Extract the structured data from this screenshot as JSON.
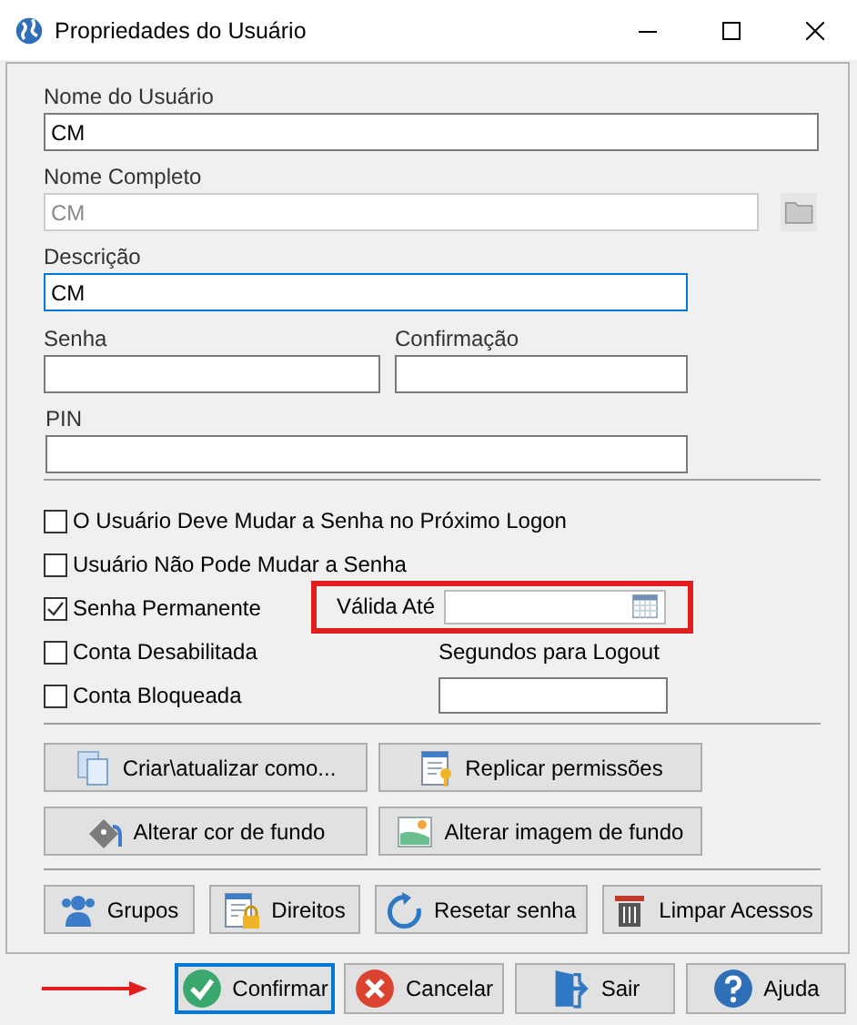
{
  "window": {
    "title": "Propriedades do Usuário",
    "controls": [
      {
        "kind": "minimize"
      },
      {
        "kind": "maximize"
      },
      {
        "kind": "close"
      }
    ]
  },
  "user_name": {
    "label": "Nome do Usuário",
    "value": "CM",
    "disabled": false,
    "focused": false
  },
  "full_name": {
    "label": "Nome Completo",
    "value": "CM",
    "disabled": true,
    "focused": false
  },
  "description": {
    "label": "Descrição",
    "value": "CM",
    "disabled": false,
    "focused": true
  },
  "password": {
    "label": "Senha",
    "disabled": false,
    "focused": false
  },
  "confirmation": {
    "label": "Confirmação",
    "disabled": false,
    "focused": false
  },
  "pin": {
    "label": "PIN",
    "disabled": false,
    "focused": false
  },
  "options": [
    {
      "label": "O Usuário Deve Mudar a Senha no Próximo Logon",
      "checked": false
    },
    {
      "label": "Usuário Não Pode Mudar a Senha",
      "checked": false
    },
    {
      "label": "Senha Permanente",
      "checked": true
    },
    {
      "label": "Conta Desabilitada",
      "checked": false
    },
    {
      "label": "Conta Bloqueada",
      "checked": false
    }
  ],
  "valid_until": {
    "label": "Válida Até",
    "highlighted": true
  },
  "logout_seconds": {
    "label": "Segundos para Logout"
  },
  "tool_buttons": [
    {
      "label": "Criar\\atualizar como...",
      "kind": "copy"
    },
    {
      "label": "Replicar permissões",
      "kind": "permissions"
    },
    {
      "label": "Alterar cor de fundo",
      "kind": "paint"
    },
    {
      "label": "Alterar imagem de fundo",
      "kind": "image"
    }
  ],
  "action_buttons": [
    {
      "label": "Grupos",
      "kind": "groups"
    },
    {
      "label": "Direitos",
      "kind": "rights"
    },
    {
      "label": "Resetar senha",
      "kind": "reset"
    },
    {
      "label": "Limpar Acessos",
      "kind": "trash"
    }
  ],
  "dialog_buttons": [
    {
      "label": "Confirmar",
      "kind": "confirm",
      "default": true,
      "pointed": true
    },
    {
      "label": "Cancelar",
      "kind": "cancel",
      "default": false,
      "pointed": false
    },
    {
      "label": "Sair",
      "kind": "exit",
      "default": false,
      "pointed": false
    },
    {
      "label": "Ajuda",
      "kind": "help",
      "default": false,
      "pointed": false
    }
  ]
}
